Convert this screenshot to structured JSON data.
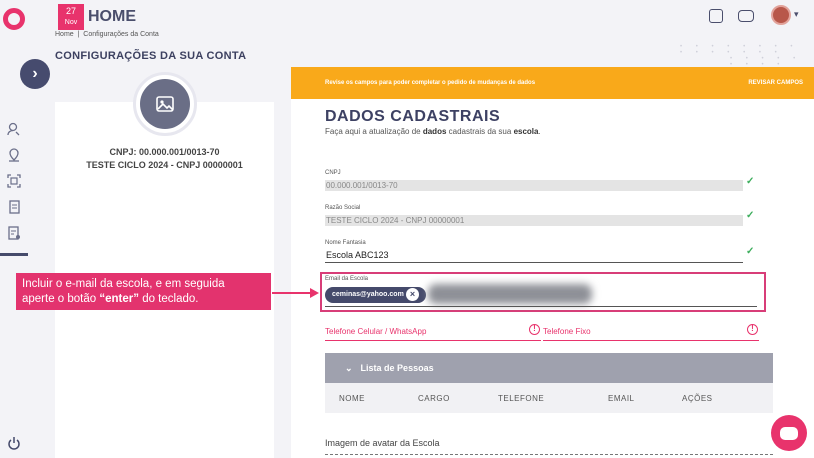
{
  "header": {
    "date_day": "27",
    "date_month": "Nov",
    "title": "HOME",
    "breadcrumb": [
      "Home",
      "Configurações da Conta"
    ],
    "page_title": "CONFIGURAÇÕES DA SUA CONTA"
  },
  "profile": {
    "cnpj": "CNPJ: 00.000.001/0013-70",
    "name": "TESTE CICLO 2024 - CNPJ 00000001"
  },
  "alert": {
    "message": "Revise os campos para poder completar o pedido de mudanças de dados",
    "action": "REVISAR CAMPOS"
  },
  "section": {
    "title": "DADOS CADASTRAIS",
    "subtitle_pre": "Faça aqui a atualização de ",
    "subtitle_b1": "dados",
    "subtitle_mid": " cadastrais da sua ",
    "subtitle_b2": "escola",
    "subtitle_post": "."
  },
  "fields": {
    "cnpj_label": "CNPJ",
    "cnpj_value": "00.000.001/0013-70",
    "razao_label": "Razão Social",
    "razao_value": "TESTE CICLO 2024 - CNPJ 00000001",
    "fantasia_label": "Nome Fantasia",
    "fantasia_value": "Escola ABC123",
    "email_label": "Email da Escola",
    "email_chip": "ceminas@yahoo.com",
    "phone_cell": "Telefone Celular / WhatsApp",
    "phone_fixed": "Telefone Fixo"
  },
  "people": {
    "title": "Lista de Pessoas",
    "columns": [
      "NOME",
      "CARGO",
      "TELEFONE",
      "EMAIL",
      "AÇÕES"
    ]
  },
  "avatar_label": "Imagem de avatar da Escola",
  "callout": {
    "line1": "Incluir o e-mail da escola, e em seguida",
    "line2_pre": "aperte o botão ",
    "line2_bold": "“enter”",
    "line2_post": " do teclado."
  },
  "colors": {
    "accent": "#e8336c",
    "warning": "#f9a91a",
    "navy": "#454a6b",
    "success": "#3cad5c"
  }
}
